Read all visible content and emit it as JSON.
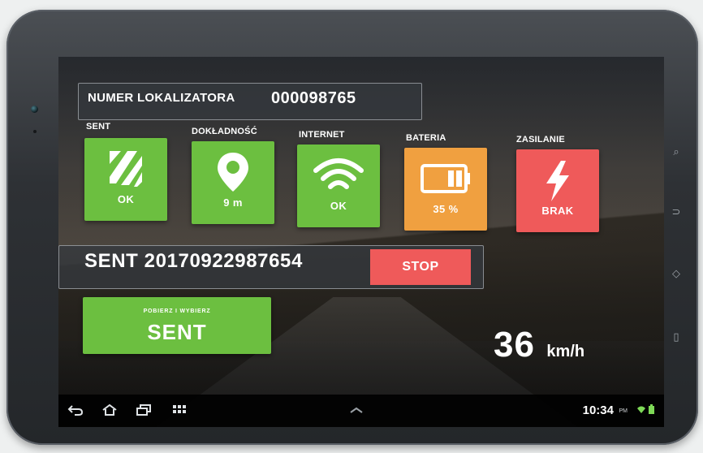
{
  "header": {
    "id_label": "NUMER LOKALIZATORA",
    "id_value": "000098765"
  },
  "tiles": [
    {
      "label": "SENT",
      "value": "OK",
      "icon": "sent-stripes-icon",
      "color": "#6cbf40"
    },
    {
      "label": "DOKŁADNOŚĆ",
      "value": "9 m",
      "icon": "location-pin-icon",
      "color": "#6cbf40"
    },
    {
      "label": "INTERNET",
      "value": "OK",
      "icon": "wifi-icon",
      "color": "#6cbf40"
    },
    {
      "label": "BATERIA",
      "value": "35 %",
      "icon": "battery-icon",
      "color": "#f0a040",
      "level_percent": 35
    },
    {
      "label": "ZASILANIE",
      "value": "BRAK",
      "icon": "lightning-icon",
      "color": "#ef5a5a"
    }
  ],
  "sent_bar": {
    "number": "SENT 20170922987654",
    "stop_label": "STOP"
  },
  "pick_button": {
    "small": "POBIERZ I WYBIERZ",
    "big": "SENT"
  },
  "speed": {
    "value": "36",
    "unit": "km/h"
  },
  "system_bar": {
    "time": "10:34",
    "ampm": "PM",
    "icons": [
      "back-icon",
      "home-icon",
      "recent-apps-icon",
      "apps-grid-icon",
      "chevron-up-icon",
      "wifi-status-icon",
      "battery-status-icon"
    ]
  },
  "colors": {
    "green": "#6cbf40",
    "orange": "#f0a040",
    "red": "#ef5a5a"
  }
}
